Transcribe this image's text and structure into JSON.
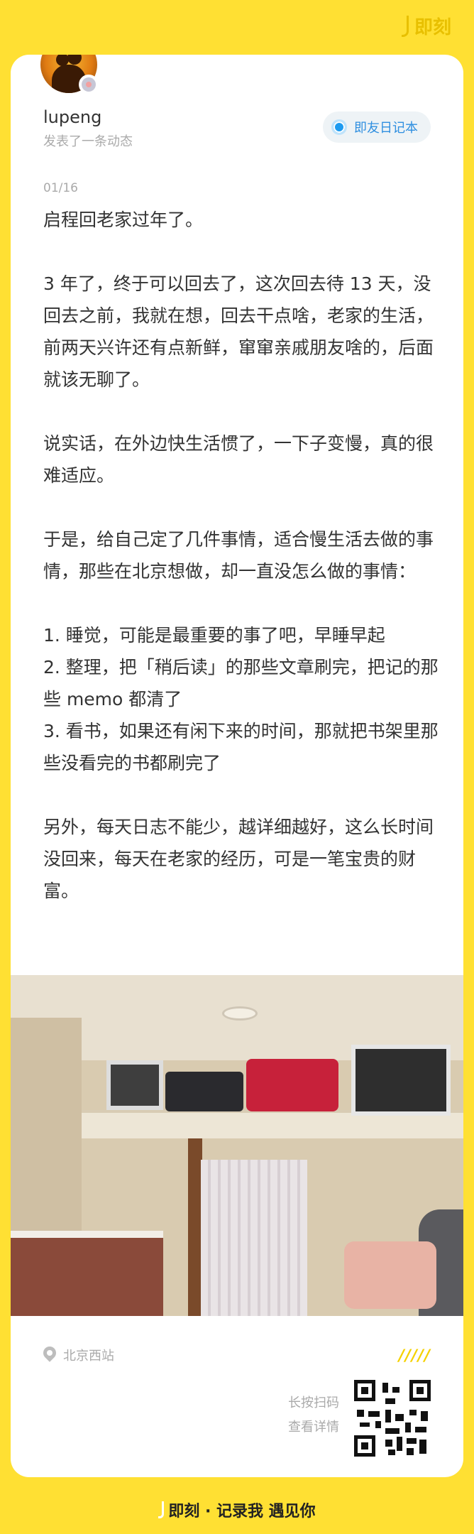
{
  "brand": {
    "top_logo": "即刻",
    "footer": "即刻 · 记录我 遇见你"
  },
  "colors": {
    "background": "#FFE033",
    "tag_text": "#2F8FE0",
    "muted": "#AAAAAA"
  },
  "profile": {
    "username": "lupeng",
    "subtitle": "发表了一条动态",
    "badge_icon": "avatar-badge-icon"
  },
  "tag": {
    "label": "即友日记本"
  },
  "post": {
    "date": "01/16",
    "paragraphs": [
      "启程回老家过年了。",
      "3 年了，终于可以回去了，这次回去待 13 天，没回去之前，我就在想，回去干点啥，老家的生活，前两天兴许还有点新鲜，窜窜亲戚朋友啥的，后面就该无聊了。",
      "说实话，在外边快生活惯了，一下子变慢，真的很难适应。",
      "于是，给自己定了几件事情，适合慢生活去做的事情，那些在北京想做，却一直没怎么做的事情：",
      "1. 睡觉，可能是最重要的事了吧，早睡早起",
      "2. 整理，把「稍后读」的那些文章刷完，把记的那些 memo 都清了",
      "3. 看书，如果还有闲下来的时间，那就把书架里那些没看完的书都刷完了",
      "另外，每天日志不能少，越详细越好，这么长时间没回来，每天在老家的经历，可是一笔宝贵的财富。"
    ]
  },
  "location": {
    "label": "北京西站"
  },
  "decoration": {
    "slashes": "/////"
  },
  "share": {
    "line1": "长按扫码",
    "line2": "查看详情"
  }
}
